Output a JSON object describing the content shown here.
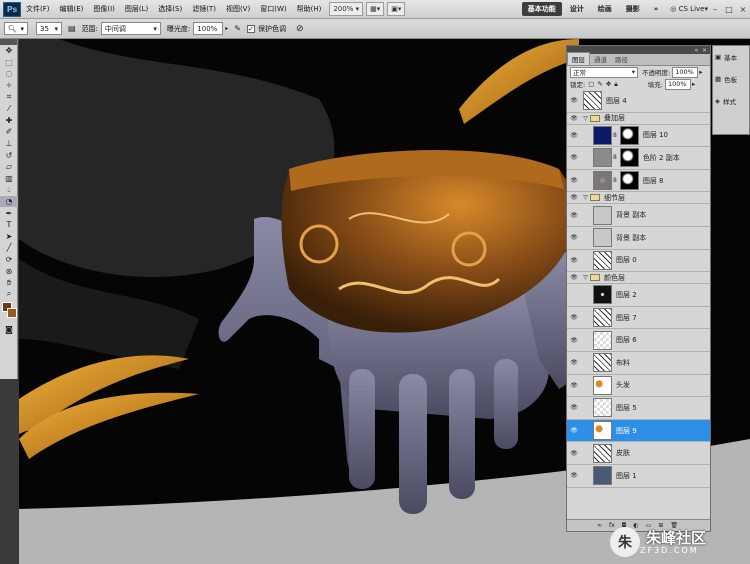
{
  "menubar": {
    "logo": "Ps",
    "menus": [
      "文件(F)",
      "编辑(E)",
      "图像(I)",
      "图层(L)",
      "选择(S)",
      "滤镜(T)",
      "视图(V)",
      "窗口(W)",
      "帮助(H)"
    ],
    "zoom": "200%",
    "workspaces": [
      "基本功能",
      "设计",
      "绘画",
      "摄影"
    ],
    "active_workspace": "基本功能",
    "cslive": "CS Live"
  },
  "options": {
    "brush_size": "35",
    "range_label": "范围:",
    "range_value": "中间调",
    "exposure_label": "曝光度:",
    "exposure_value": "100%",
    "protect_tones_label": "保护色调",
    "protect_tones_checked": true
  },
  "colors": {
    "foreground": "#6a3a10",
    "background": "#9a5a1a",
    "selection": "#2e8fe8"
  },
  "layers_panel": {
    "tabs": [
      "图层",
      "通道",
      "路径"
    ],
    "active_tab": "图层",
    "blend_mode": "正常",
    "opacity_label": "不透明度:",
    "opacity": "100%",
    "lock_label": "锁定:",
    "fill_label": "填充:",
    "fill": "100%",
    "layers": [
      {
        "kind": "layer",
        "name": "图层 4",
        "visible": true,
        "thumb": "sketch",
        "indent": false
      },
      {
        "kind": "group",
        "name": "叠加层",
        "visible": true
      },
      {
        "kind": "layer",
        "name": "图层 10",
        "visible": true,
        "thumb": "navy",
        "mask": true,
        "indent": true
      },
      {
        "kind": "layer",
        "name": "色阶 2 副本",
        "visible": true,
        "thumb": "gray",
        "mask": true,
        "indent": true
      },
      {
        "kind": "layer",
        "name": "图层 8",
        "visible": true,
        "thumb": "texture",
        "mask": true,
        "indent": true
      },
      {
        "kind": "group",
        "name": "细节层",
        "visible": true
      },
      {
        "kind": "layer",
        "name": "背景 副本",
        "visible": true,
        "thumb": "lightgray",
        "indent": true
      },
      {
        "kind": "layer",
        "name": "背景 副本",
        "visible": true,
        "thumb": "lightgray",
        "indent": true
      },
      {
        "kind": "layer",
        "name": "图层 0",
        "visible": true,
        "thumb": "sketch",
        "indent": true
      },
      {
        "kind": "group",
        "name": "颜色层",
        "visible": true
      },
      {
        "kind": "layer",
        "name": "图层 2",
        "visible": false,
        "thumb": "dark",
        "indent": true
      },
      {
        "kind": "layer",
        "name": "图层 7",
        "visible": true,
        "thumb": "sketch",
        "indent": true
      },
      {
        "kind": "layer",
        "name": "图层 6",
        "visible": true,
        "thumb": "checker",
        "indent": true
      },
      {
        "kind": "layer",
        "name": "布料",
        "visible": true,
        "thumb": "sketch",
        "indent": true
      },
      {
        "kind": "layer",
        "name": "头发",
        "visible": true,
        "thumb": "hair",
        "indent": true
      },
      {
        "kind": "layer",
        "name": "图层 5",
        "visible": true,
        "thumb": "checker",
        "indent": true
      },
      {
        "kind": "layer",
        "name": "图层 9",
        "visible": true,
        "thumb": "hair",
        "indent": true,
        "selected": true
      },
      {
        "kind": "layer",
        "name": "皮肤",
        "visible": true,
        "thumb": "sketch",
        "indent": true
      },
      {
        "kind": "layer",
        "name": "图层 1",
        "visible": true,
        "thumb": "slate",
        "indent": true
      }
    ]
  },
  "dock": {
    "items": [
      "基本",
      "色板",
      "样式"
    ]
  },
  "watermark": {
    "logo": "朱",
    "title": "朱峰社区",
    "site": "ZF3D.COM"
  }
}
